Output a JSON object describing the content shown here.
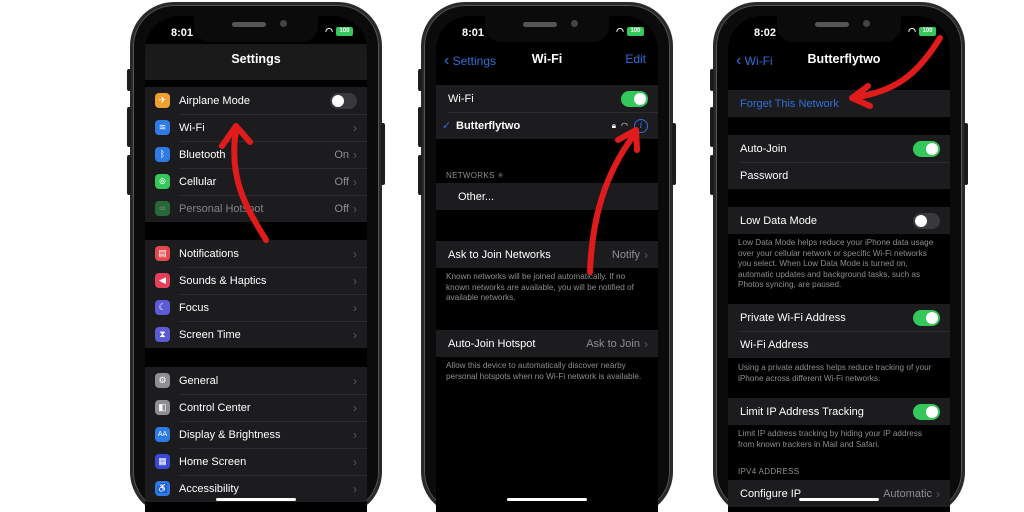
{
  "phones": [
    {
      "status": {
        "time": "8:01",
        "battery": "100"
      },
      "nav": {
        "title": "Settings"
      },
      "groups": [
        {
          "items": [
            {
              "icon": "airplane-icon",
              "glyph": "✈",
              "color": "#f0a030",
              "label": "Airplane Mode",
              "toggle": false
            },
            {
              "icon": "wifi-icon",
              "glyph": "≋",
              "color": "#2f7ae5",
              "label": "Wi-Fi",
              "value": ""
            },
            {
              "icon": "bluetooth-icon",
              "glyph": "ᛒ",
              "color": "#2f7ae5",
              "label": "Bluetooth",
              "value": "On"
            },
            {
              "icon": "cellular-icon",
              "glyph": "⊚",
              "color": "#34c759",
              "label": "Cellular",
              "value": "Off"
            },
            {
              "icon": "hotspot-icon",
              "glyph": "∞",
              "color": "#34c759",
              "label": "Personal Hotspot",
              "value": "Off",
              "dim": true
            }
          ]
        },
        {
          "items": [
            {
              "icon": "notifications-icon",
              "glyph": "▤",
              "color": "#e5484d",
              "label": "Notifications"
            },
            {
              "icon": "sounds-icon",
              "glyph": "◀",
              "color": "#e5405a",
              "label": "Sounds & Haptics"
            },
            {
              "icon": "focus-icon",
              "glyph": "☾",
              "color": "#5b5bd6",
              "label": "Focus"
            },
            {
              "icon": "screen-time-icon",
              "glyph": "⧗",
              "color": "#5b5bd6",
              "label": "Screen Time"
            }
          ]
        },
        {
          "items": [
            {
              "icon": "general-icon",
              "glyph": "⚙",
              "color": "#8e8e93",
              "label": "General"
            },
            {
              "icon": "control-center-icon",
              "glyph": "◧",
              "color": "#8e8e93",
              "label": "Control Center"
            },
            {
              "icon": "display-icon",
              "glyph": "AA",
              "color": "#2f7ae5",
              "label": "Display & Brightness"
            },
            {
              "icon": "home-screen-icon",
              "glyph": "▦",
              "color": "#3a4ad6",
              "label": "Home Screen"
            },
            {
              "icon": "accessibility-icon",
              "glyph": "♿",
              "color": "#2f7ae5",
              "label": "Accessibility"
            }
          ]
        }
      ]
    },
    {
      "status": {
        "time": "8:01",
        "battery": "100"
      },
      "nav": {
        "back": "Settings",
        "title": "Wi-Fi",
        "right": "Edit"
      },
      "wifi_row": {
        "label": "Wi-Fi",
        "toggle": true
      },
      "connected": {
        "check": "✓",
        "label": "Butterflytwo"
      },
      "networks_header": "NETWORKS",
      "other": "Other...",
      "ask_join": {
        "label": "Ask to Join Networks",
        "value": "Notify"
      },
      "ask_join_note": "Known networks will be joined automatically. If no known networks are available, you will be notified of available networks.",
      "auto_hotspot": {
        "label": "Auto-Join Hotspot",
        "value": "Ask to Join"
      },
      "auto_hotspot_note": "Allow this device to automatically discover nearby personal hotspots when no Wi-Fi network is available."
    },
    {
      "status": {
        "time": "8:02",
        "battery": "100"
      },
      "nav": {
        "back": "Wi-Fi",
        "title": "Butterflytwo"
      },
      "forget": "Forget This Network",
      "auto_join": {
        "label": "Auto-Join",
        "toggle": true
      },
      "password": "Password",
      "low_data": {
        "label": "Low Data Mode",
        "toggle": false
      },
      "low_data_note": "Low Data Mode helps reduce your iPhone data usage over your cellular network or specific Wi-Fi networks you select. When Low Data Mode is turned on, automatic updates and background tasks, such as Photos syncing, are paused.",
      "private_addr": {
        "label": "Private Wi-Fi Address",
        "toggle": true
      },
      "wifi_address": "Wi-Fi Address",
      "private_note": "Using a private address helps reduce tracking of your iPhone across different Wi-Fi networks.",
      "limit_ip": {
        "label": "Limit IP Address Tracking",
        "toggle": true
      },
      "limit_ip_note": "Limit IP address tracking by hiding your IP address from known trackers in Mail and Safari.",
      "ipv4_header": "IPV4 ADDRESS",
      "configure_ip": {
        "label": "Configure IP",
        "value": "Automatic"
      }
    }
  ],
  "colors": {
    "accent": "#2f6fd6",
    "toggle_on": "#34c759",
    "annotation_arrow": "#e01b1b"
  },
  "chevron": "›",
  "back_chevron": "‹"
}
